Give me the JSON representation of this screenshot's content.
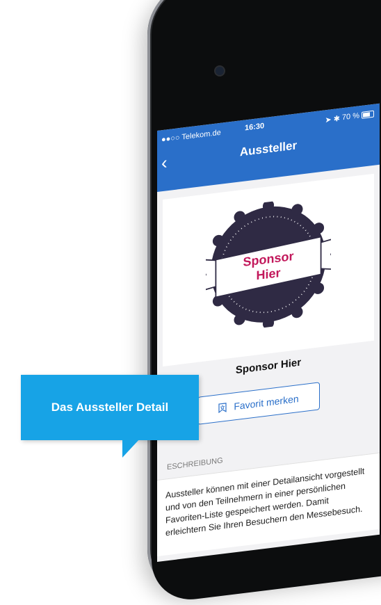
{
  "status_bar": {
    "carrier": "●●○○ Telekom.de",
    "time": "16:30",
    "battery": "70 %"
  },
  "nav": {
    "back": "‹",
    "title": "Aussteller"
  },
  "logo": {
    "text_line1": "Sponsor",
    "text_line2": "Hier",
    "badge_color": "#2f2a44",
    "text_color": "#c2185b"
  },
  "exhibitor_name": "Sponsor Hier",
  "favorite_button": {
    "label": "Favorit merken"
  },
  "section_label": "ESCHREIBUNG",
  "description": "Aussteller können mit einer Detailansicht vorgestellt und von den Teilnehmern in einer persönlichen Favoriten-Liste gespeichert werden. Damit erleichtern Sie Ihren Besuchern den Messebesuch.",
  "callout": {
    "label": "Das Aussteller Detail"
  },
  "colors": {
    "accent": "#2a6fc9",
    "callout": "#17a3e6"
  }
}
